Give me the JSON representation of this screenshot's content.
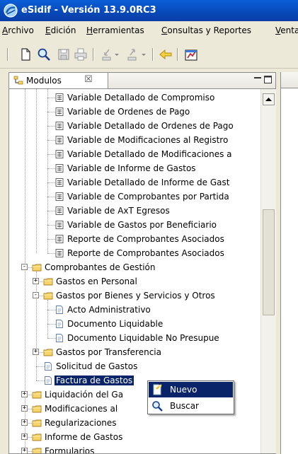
{
  "window": {
    "title": "eSidif - Versión 13.9.0RC3"
  },
  "menu": [
    {
      "pre": "",
      "u": "A",
      "post": "rchivo"
    },
    {
      "pre": "",
      "u": "E",
      "post": "dición"
    },
    {
      "pre": "",
      "u": "H",
      "post": "erramientas"
    },
    {
      "pre": "",
      "u": "C",
      "post": "onsultas y Reportes"
    },
    {
      "pre": "",
      "u": "V",
      "post": "enta"
    }
  ],
  "view_tab": {
    "label": "Modulos",
    "close": "☒"
  },
  "tree": [
    {
      "label": "Variable Detallado de Compromiso",
      "icon": "report-icon"
    },
    {
      "label": "Variable de Ordenes de Pago",
      "icon": "report-icon"
    },
    {
      "label": "Variable Detallado de Ordenes de Pago",
      "icon": "report-icon"
    },
    {
      "label": "Variable de Modificaciones al Registro",
      "icon": "report-icon"
    },
    {
      "label": "Variable Detallado de Modificaciones a",
      "icon": "report-icon"
    },
    {
      "label": "Variable de Informe de Gastos",
      "icon": "report-icon"
    },
    {
      "label": "Variable Detallado de Informe de Gast",
      "icon": "report-icon"
    },
    {
      "label": "Variable de Comprobantes por Partida",
      "icon": "report-icon"
    },
    {
      "label": "Variable de AxT Egresos",
      "icon": "report-icon"
    },
    {
      "label": "Variable de Gastos por Beneficiario",
      "icon": "report-icon"
    },
    {
      "label": "Reporte de Comprobantes Asociados",
      "icon": "report-icon"
    },
    {
      "label": "Reporte de Comprobantes Asociados",
      "icon": "report-icon"
    },
    {
      "label": "Comprobantes de Gestión",
      "icon": "folder-icon"
    },
    {
      "label": "Gastos en Personal",
      "icon": "folder-icon"
    },
    {
      "label": "Gastos por Bienes y Servicios y Otros",
      "icon": "folder-icon"
    },
    {
      "label": "Acto Administrativo",
      "icon": "document-icon"
    },
    {
      "label": "Documento Liquidable",
      "icon": "document-icon"
    },
    {
      "label": "Documento Liquidable No Presupue",
      "icon": "document-icon"
    },
    {
      "label": "Gastos por Transferencia",
      "icon": "folder-icon"
    },
    {
      "label": "Solicitud de Gastos",
      "icon": "document-icon"
    },
    {
      "label": "Factura de Gastos",
      "icon": "document-icon"
    },
    {
      "label": "Liquidación del Ga",
      "icon": "folder-icon"
    },
    {
      "label": "Modificaciones al",
      "icon": "folder-icon"
    },
    {
      "label": "Regularizaciones",
      "icon": "folder-icon"
    },
    {
      "label": "Informe de Gastos",
      "icon": "folder-icon"
    },
    {
      "label": "Formularios",
      "icon": "folder-icon"
    }
  ],
  "context_menu": [
    {
      "label": "Nuevo",
      "icon": "new-icon"
    },
    {
      "label": "Buscar",
      "icon": "search-icon"
    }
  ],
  "colors": {
    "title_bar": "#0a5fd8",
    "selection": "#0a246a",
    "folder": "#f6d36b"
  }
}
